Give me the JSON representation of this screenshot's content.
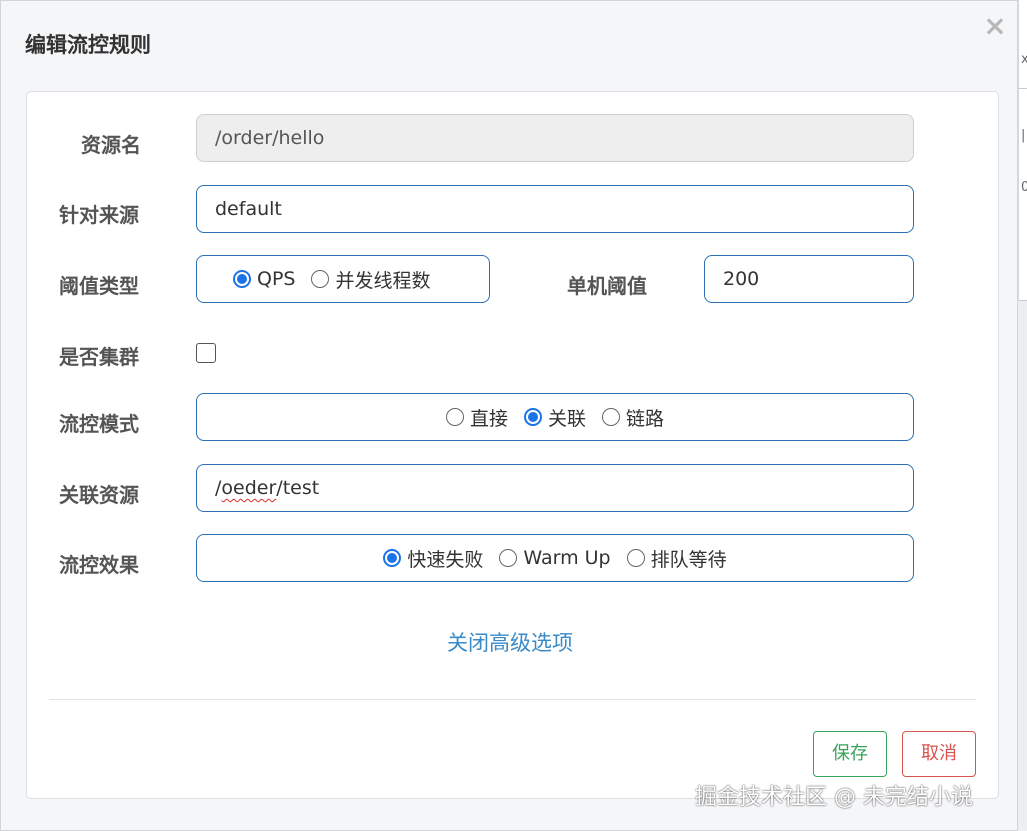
{
  "dialog": {
    "title": "编辑流控规则",
    "close_glyph": "×"
  },
  "background_page": {
    "chars": [
      "x",
      "|",
      "0"
    ]
  },
  "form": {
    "resource_name": {
      "label": "资源名",
      "value": "/order/hello"
    },
    "limit_app": {
      "label": "针对来源",
      "value": "default"
    },
    "grade": {
      "label": "阈值类型",
      "options": [
        "QPS",
        "并发线程数"
      ],
      "selected": "QPS"
    },
    "threshold": {
      "label": "单机阈值",
      "value": "200"
    },
    "cluster": {
      "label": "是否集群",
      "checked": false
    },
    "strategy": {
      "label": "流控模式",
      "options": [
        "直接",
        "关联",
        "链路"
      ],
      "selected": "关联"
    },
    "ref_resource": {
      "label": "关联资源",
      "value_prefix": "/",
      "value_misspelled": "oeder",
      "value_suffix": "/test"
    },
    "control_behavior": {
      "label": "流控效果",
      "options": [
        "快速失败",
        "Warm Up",
        "排队等待"
      ],
      "selected": "快速失败"
    }
  },
  "advanced_toggle": "关闭高级选项",
  "buttons": {
    "save": "保存",
    "cancel": "取消"
  },
  "watermark": "掘金技术社区 @ 未完结小说",
  "colors": {
    "accent": "#1b73e8",
    "field_border": "#2b6fb3",
    "link": "#3a8ac8",
    "save": "#3aa35b",
    "cancel": "#d9534f"
  }
}
